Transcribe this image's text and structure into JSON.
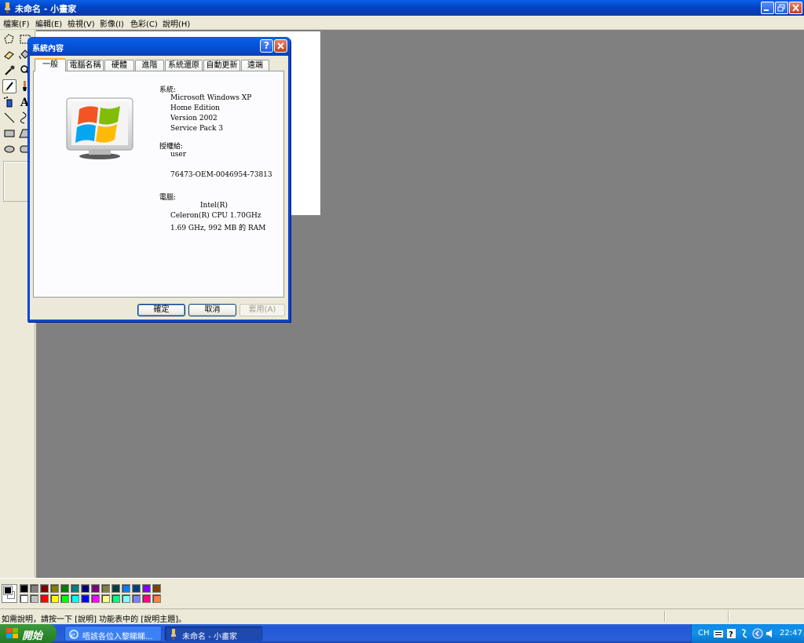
{
  "window": {
    "title": "未命名 - 小畫家"
  },
  "menu": [
    "檔案(F)",
    "編輯(E)",
    "檢視(V)",
    "影像(I)",
    "色彩(C)",
    "說明(H)"
  ],
  "tools": [
    "free-select",
    "select",
    "eraser",
    "fill",
    "color-picker",
    "magnifier",
    "pencil",
    "brush",
    "airbrush",
    "text",
    "line",
    "curve",
    "rectangle",
    "polygon",
    "ellipse",
    "rounded-rectangle"
  ],
  "palette": {
    "foreground": "#000000",
    "background": "#ffffff",
    "row1": [
      "#000000",
      "#808080",
      "#800000",
      "#808000",
      "#008000",
      "#008080",
      "#000080",
      "#800080",
      "#808040",
      "#004040",
      "#0080ff",
      "#004080",
      "#8000ff",
      "#804000"
    ],
    "row2": [
      "#ffffff",
      "#c0c0c0",
      "#ff0000",
      "#ffff00",
      "#00ff00",
      "#00ffff",
      "#0000ff",
      "#ff00ff",
      "#ffff80",
      "#00ff80",
      "#80ffff",
      "#8080ff",
      "#ff0080",
      "#ff8040"
    ]
  },
  "status": {
    "text": "如需說明，請按一下 [說明] 功能表中的 [說明主題]。"
  },
  "dialog": {
    "title": "系統內容",
    "tabs": [
      "一般",
      "電腦名稱",
      "硬體",
      "進階",
      "系統還原",
      "自動更新",
      "遠端"
    ],
    "system_label": "系統:",
    "system_lines": [
      "Microsoft Windows XP",
      "Home Edition",
      "Version 2002",
      "Service Pack 3"
    ],
    "registered_label": "授權給:",
    "registered_user": "user",
    "product_id": "76473-OEM-0046954-73813",
    "computer_label": "電腦:",
    "computer_lines": [
      "Intel(R)",
      "Celeron(R) CPU 1.70GHz",
      "1.69 GHz, 992 MB 的 RAM"
    ],
    "buttons": {
      "ok": "確定",
      "cancel": "取消",
      "apply": "套用(A)"
    }
  },
  "taskbar": {
    "start_label": "開始",
    "tasks": [
      "唔該各位入黎睇睇...",
      "未命名 - 小畫家"
    ],
    "tray_lang": "CH",
    "clock": "22:47"
  }
}
